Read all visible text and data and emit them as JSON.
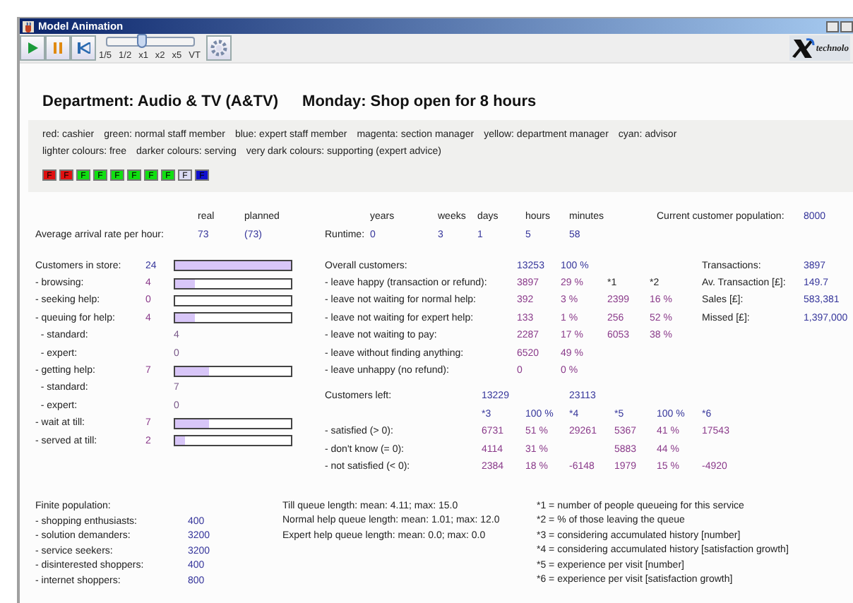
{
  "window": {
    "title": "Model Animation"
  },
  "toolbar": {
    "speed_slider": {
      "level": 0.41,
      "ticks": [
        "1/5",
        "1/2",
        "x1",
        "x2",
        "x5",
        "VT"
      ]
    },
    "logo_text": "technolo"
  },
  "heading": {
    "department": "Department: Audio & TV (A&TV)",
    "schedule": "Monday: Shop open for 8 hours"
  },
  "legend": {
    "roles": [
      "red: cashier",
      "green: normal staff member",
      "blue: expert staff member",
      "magenta: section manager",
      "yellow: department manager",
      "cyan: advisor"
    ],
    "shades": [
      "lighter colours: free",
      "darker colours: serving",
      "very dark colours: supporting (expert advice)"
    ],
    "staff": [
      {
        "label": "F",
        "color": "#e01010"
      },
      {
        "label": "F",
        "color": "#e01010"
      },
      {
        "label": "F",
        "color": "#10e010"
      },
      {
        "label": "F",
        "color": "#10e010"
      },
      {
        "label": "F",
        "color": "#10e010"
      },
      {
        "label": "F",
        "color": "#10e010"
      },
      {
        "label": "F",
        "color": "#10e010"
      },
      {
        "label": "F",
        "color": "#10e010"
      },
      {
        "label": "F",
        "color": "#dcdcf4"
      },
      {
        "label": "F",
        "color": "#1010d0"
      }
    ]
  },
  "arrival": {
    "headers": [
      "real",
      "planned"
    ],
    "label": "Average arrival rate per hour:",
    "real": "73",
    "planned": "(73)"
  },
  "runtime": {
    "label": "Runtime:",
    "units": [
      {
        "unit": "years",
        "value": "0"
      },
      {
        "unit": "weeks",
        "value": "3"
      },
      {
        "unit": "days",
        "value": "1"
      },
      {
        "unit": "hours",
        "value": "5"
      },
      {
        "unit": "minutes",
        "value": "58"
      }
    ]
  },
  "population": {
    "label": "Current customer population:",
    "value": "8000"
  },
  "store": [
    {
      "label": "Customers in store:",
      "value": "24",
      "kind": "total",
      "level": 1
    },
    {
      "label": "- browsing:",
      "value": "4",
      "kind": "bar",
      "level": 0.17
    },
    {
      "label": "- seeking help:",
      "value": "0",
      "kind": "bar",
      "level": 0
    },
    {
      "label": "- queuing for help:",
      "value": "4",
      "kind": "bar",
      "level": 0.17
    },
    {
      "label": "- standard:",
      "value": "4",
      "kind": "sub"
    },
    {
      "label": "- expert:",
      "value": "0",
      "kind": "sub"
    },
    {
      "label": "- getting help:",
      "value": "7",
      "kind": "bar",
      "level": 0.29
    },
    {
      "label": "- standard:",
      "value": "7",
      "kind": "sub"
    },
    {
      "label": "- expert:",
      "value": "0",
      "kind": "sub"
    },
    {
      "label": "- wait at till:",
      "value": "7",
      "kind": "bar",
      "level": 0.29
    },
    {
      "label": "- served at till:",
      "value": "2",
      "kind": "bar",
      "level": 0.08
    }
  ],
  "overall": [
    {
      "label": "Overall customers:",
      "cells": [
        "13253",
        "100 %"
      ]
    },
    {
      "label": "- leave happy (transaction or refund):",
      "cells": [
        "3897",
        "29 %",
        "*1",
        "*2"
      ]
    },
    {
      "label": "- leave not waiting for normal help:",
      "cells": [
        "392",
        "3 %",
        "2399",
        "16 %"
      ]
    },
    {
      "label": "- leave not waiting for expert help:",
      "cells": [
        "133",
        "1 %",
        "256",
        "52 %"
      ]
    },
    {
      "label": "- leave not waiting to pay:",
      "cells": [
        "2287",
        "17 %",
        "6053",
        "38 %"
      ]
    },
    {
      "label": "- leave without finding anything:",
      "cells": [
        "6520",
        "49 %"
      ]
    },
    {
      "label": "- leave unhappy (no refund):",
      "cells": [
        "0",
        "0 %"
      ]
    }
  ],
  "transactions": [
    {
      "label": "Transactions:",
      "value": "3897"
    },
    {
      "label": "Av. Transaction [£]:",
      "value": "149.7"
    },
    {
      "label": "Sales [£]:",
      "value": "583,381"
    },
    {
      "label": "Missed [£]:",
      "value": "1,397,000"
    }
  ],
  "customers_left": {
    "label": "Customers left:",
    "history_total": "13229",
    "visit_total": "23113",
    "headers": [
      "*3",
      "100 %",
      "*4",
      "*5",
      "100 %",
      "*6"
    ],
    "rows": [
      {
        "label": "- satisfied (> 0):",
        "history": "6731",
        "history_share": "51 %",
        "history_growth": "29261",
        "visit": "5367",
        "visit_share": "41 %",
        "visit_growth": "17543"
      },
      {
        "label": "- don't know (= 0):",
        "history": "4114",
        "history_share": "31 %",
        "visit": "5883",
        "visit_share": "44 %"
      },
      {
        "label": "- not satisfied (< 0):",
        "history": "2384",
        "history_share": "18 %",
        "history_growth": "-6148",
        "visit": "1979",
        "visit_share": "15 %",
        "visit_growth": "-4920"
      }
    ]
  },
  "finite": {
    "label": "Finite population:",
    "groups": [
      {
        "label": "- shopping enthusiasts:",
        "value": "400"
      },
      {
        "label": "- solution demanders:",
        "value": "3200"
      },
      {
        "label": "- service seekers:",
        "value": "3200"
      },
      {
        "label": "- disinterested shoppers:",
        "value": "400"
      },
      {
        "label": "- internet shoppers:",
        "value": "800"
      }
    ]
  },
  "queues": [
    "Till queue length: mean: 4.11; max: 15.0",
    "Normal help queue length: mean: 1.01; max: 12.0",
    "Expert help queue length: mean: 0.0; max: 0.0"
  ],
  "footnotes": [
    "*1 = number of people queueing for this service",
    "*2 = % of those leaving the queue",
    "*3 = considering accumulated history [number]",
    "*4 = considering accumulated history [satisfaction growth]",
    "*5 = experience per visit [number]",
    "*6 = experience per visit [satisfaction growth]"
  ]
}
